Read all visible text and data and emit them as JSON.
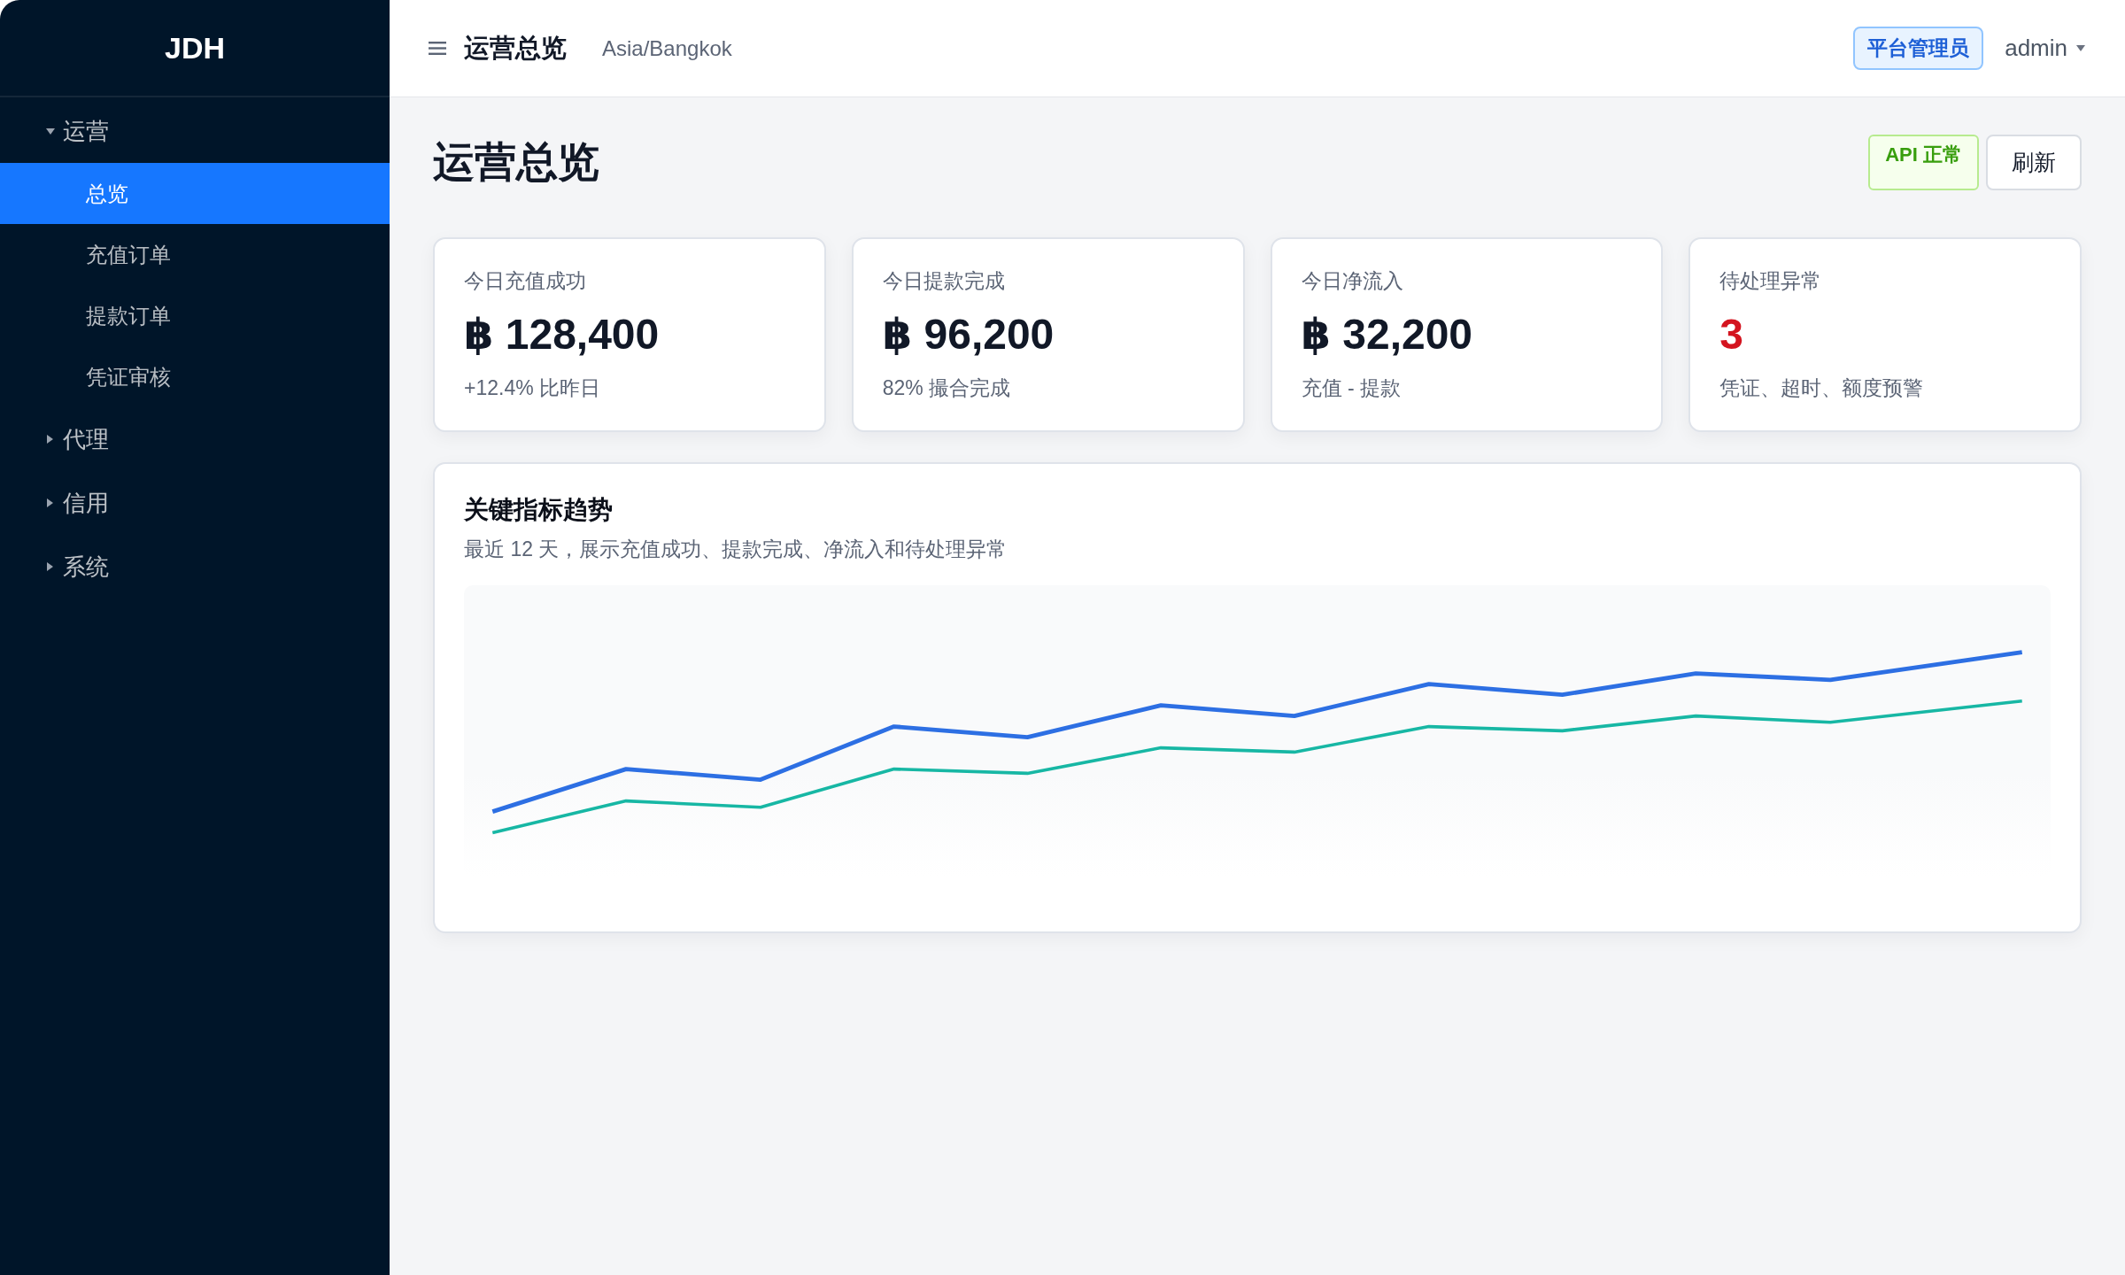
{
  "sidebar": {
    "logo": "JDH",
    "groups": [
      {
        "label": "运营",
        "expanded": true,
        "children": [
          {
            "label": "总览",
            "selected": true
          },
          {
            "label": "充值订单",
            "selected": false
          },
          {
            "label": "提款订单",
            "selected": false
          },
          {
            "label": "凭证审核",
            "selected": false
          }
        ]
      },
      {
        "label": "代理",
        "expanded": false
      },
      {
        "label": "信用",
        "expanded": false
      },
      {
        "label": "系统",
        "expanded": false
      }
    ]
  },
  "header": {
    "title": "运营总览",
    "timezone": "Asia/Bangkok",
    "role_badge": "平台管理员",
    "user": "admin"
  },
  "page": {
    "title": "运营总览",
    "api_status": {
      "label": "API 正常",
      "kind": "success"
    },
    "refresh_button": "刷新"
  },
  "stat_cards": [
    {
      "label": "今日充值成功",
      "value": "฿ 128,400",
      "note": "+12.4% 比昨日",
      "kind": "amount"
    },
    {
      "label": "今日提款完成",
      "value": "฿ 96,200",
      "note": "82% 撮合完成",
      "kind": "amount"
    },
    {
      "label": "今日净流入",
      "value": "฿ 32,200",
      "note": "充值 - 提款",
      "kind": "amount"
    },
    {
      "label": "待处理异常",
      "value": "3",
      "note": "凭证、超时、额度预警",
      "kind": "alert"
    }
  ],
  "trend_card": {
    "title": "关键指标趋势",
    "subtitle": "最近 12 天，展示充值成功、提款完成、净流入和待处理异常"
  }
}
